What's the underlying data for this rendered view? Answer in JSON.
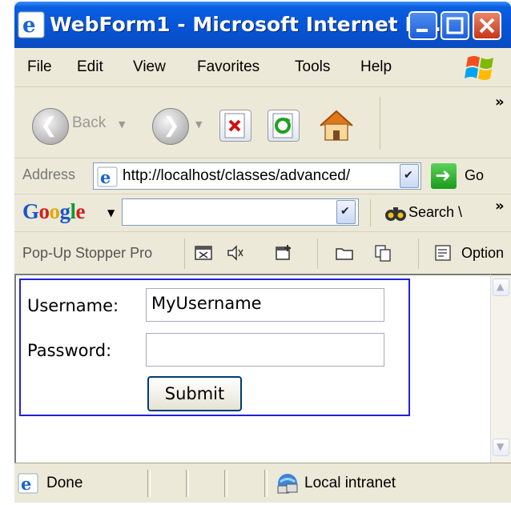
{
  "window": {
    "title": "WebForm1 - Microsoft Internet E..."
  },
  "menu": {
    "items": [
      "File",
      "Edit",
      "View",
      "Favorites",
      "Tools",
      "Help"
    ]
  },
  "toolbar": {
    "back_label": "Back",
    "overflow": "»"
  },
  "address": {
    "label": "Address",
    "url": "http://localhost/classes/advanced/",
    "go_label": "Go"
  },
  "google": {
    "logo": "Google",
    "search_label": "Search \\",
    "search_value": ""
  },
  "popup": {
    "label": "Pop-Up Stopper Pro",
    "options_label": "Option"
  },
  "form": {
    "username_label": "Username:",
    "username_value": "MyUsername",
    "password_label": "Password:",
    "password_value": "",
    "submit_label": "Submit"
  },
  "status": {
    "text": "Done",
    "zone": "Local intranet"
  },
  "colors": {
    "title_bar": "#0654d6",
    "form_border": "#2020e0",
    "chrome": "#ece9d8"
  }
}
